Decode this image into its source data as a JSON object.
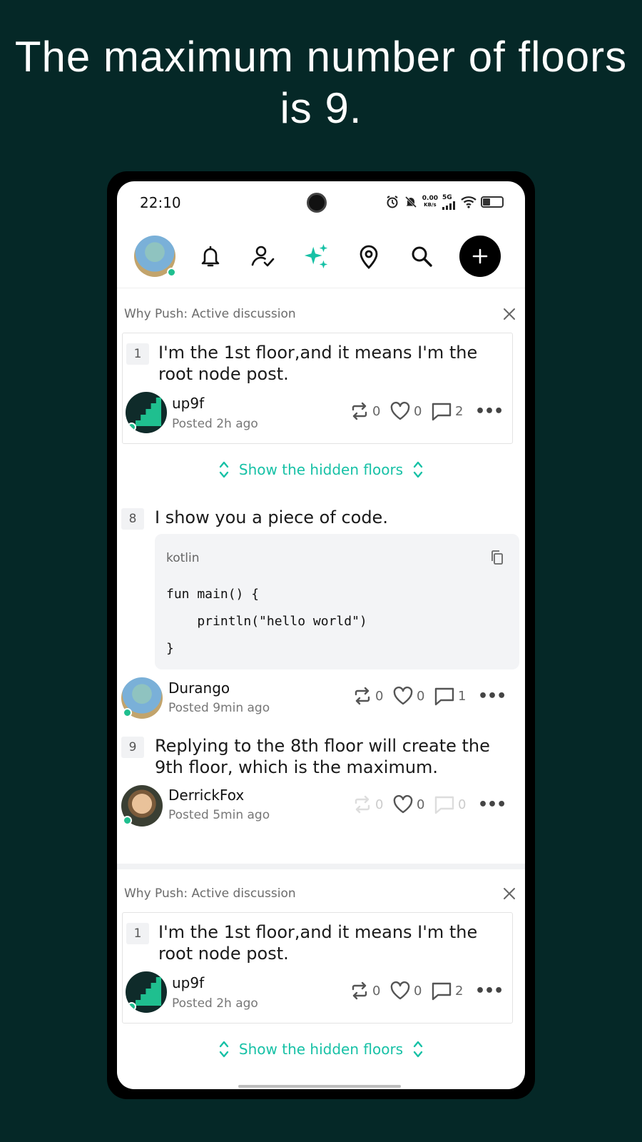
{
  "headline": "The maximum number of floors is 9.",
  "status_bar": {
    "time": "22:10",
    "net_speed_value": "0.00",
    "net_speed_unit": "KB/s",
    "network": "5G"
  },
  "accent_color": "#17c1a6",
  "feed": {
    "why_push_label": "Why Push: Active discussion",
    "show_hidden_label": "Show the hidden floors",
    "root_post": {
      "floor": "1",
      "text": "I'm the 1st floor,and it means I'm the root node post.",
      "author": "up9f",
      "posted": "Posted 2h ago",
      "reposts": "0",
      "likes": "0",
      "comments": "2"
    },
    "floor8": {
      "floor": "8",
      "text": "I show you a piece of code.",
      "code_lang": "kotlin",
      "code_line1": "fun main() {",
      "code_line2": "    println(\"hello world\")",
      "code_line3": "}",
      "author": "Durango",
      "posted": "Posted 9min ago",
      "reposts": "0",
      "likes": "0",
      "comments": "1"
    },
    "floor9": {
      "floor": "9",
      "text": "Replying to the 8th floor will create the 9th floor, which is the maximum.",
      "author": "DerrickFox",
      "posted": "Posted 5min ago",
      "reposts": "0",
      "likes": "0",
      "comments": "0"
    }
  }
}
